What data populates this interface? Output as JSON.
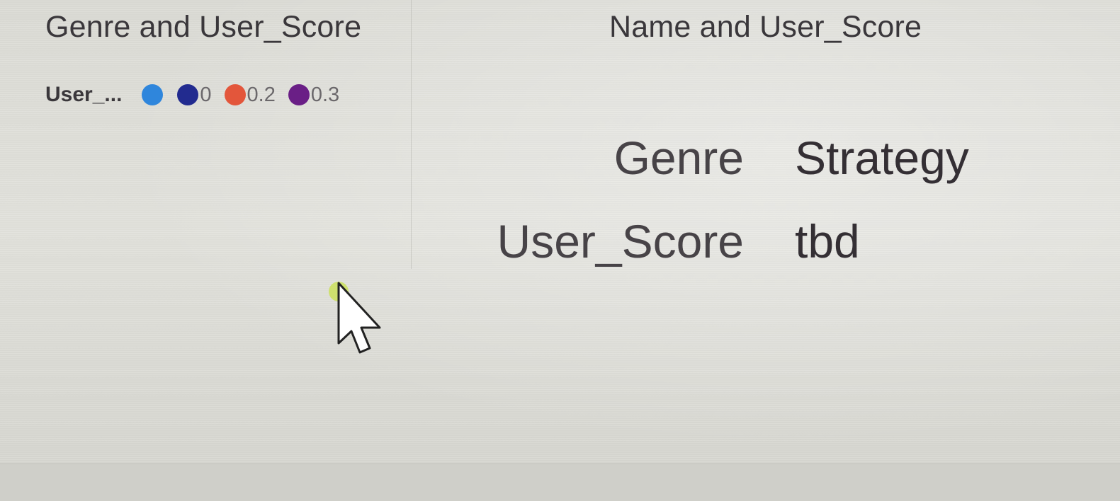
{
  "visuals": {
    "genre_user_score": {
      "title": "Genre and User_Score",
      "legend": {
        "title": "User_...",
        "items": [
          {
            "label": "",
            "color": "#2f86dc"
          },
          {
            "label": "0",
            "color": "#222b8f"
          },
          {
            "label": "0.2",
            "color": "#e3563b"
          },
          {
            "label": "0.3",
            "color": "#6a1f86"
          }
        ]
      }
    },
    "name_user_score": {
      "title": "Name and User_Score",
      "card": {
        "rows": [
          {
            "label": "Genre",
            "value": "Strategy"
          },
          {
            "label": "User_Score",
            "value": "tbd"
          }
        ]
      }
    }
  },
  "cursor": {
    "icon": "arrow-pointer-icon",
    "highlight_color": "#c8e04a"
  }
}
